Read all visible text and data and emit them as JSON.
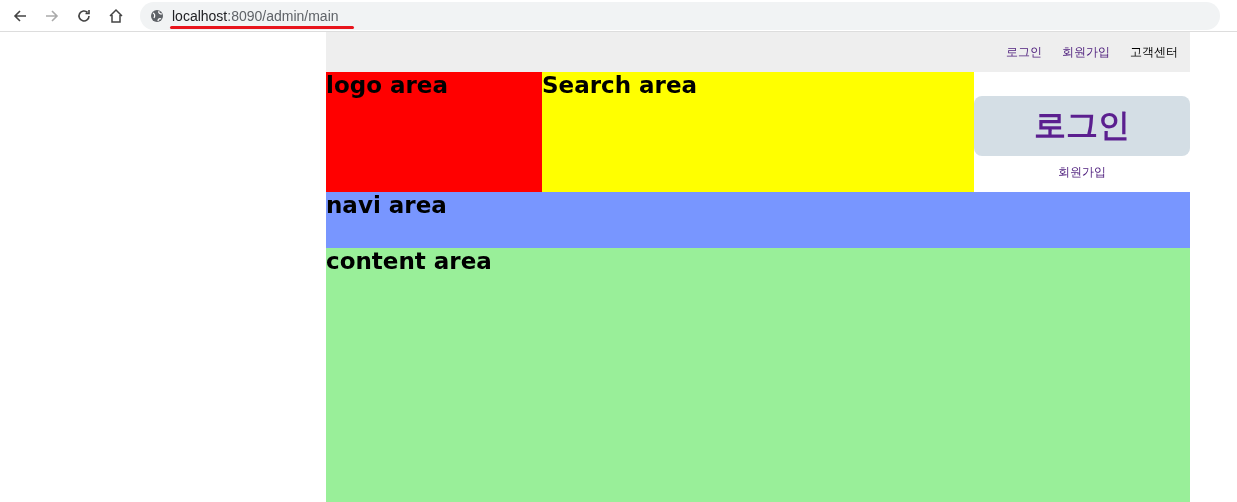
{
  "browser": {
    "url_host": "localhost",
    "url_path": ":8090/admin/main"
  },
  "top_links": [
    {
      "label": "로그인",
      "visited": true
    },
    {
      "label": "회원가입",
      "visited": true
    },
    {
      "label": "고객센터",
      "visited": false
    }
  ],
  "logo_area": {
    "label": "logo area"
  },
  "search_area": {
    "label": "Search area"
  },
  "login_box": {
    "button": "로그인",
    "button_visited": true,
    "signup": "회원가입",
    "signup_visited": true
  },
  "navi_area": {
    "label": "navi area"
  },
  "content_area": {
    "label": "content area"
  }
}
